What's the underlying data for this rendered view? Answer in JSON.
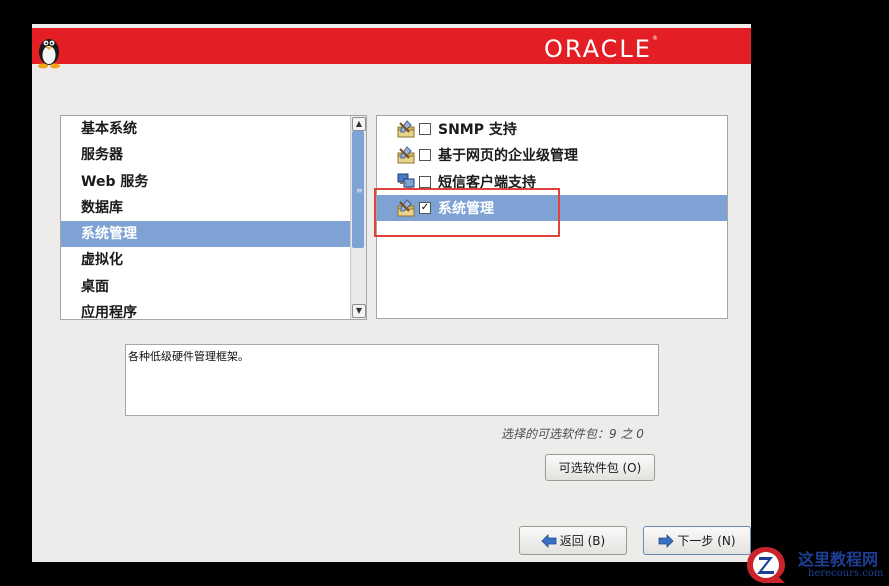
{
  "banner": {
    "brand": "ORACLE"
  },
  "categories": {
    "items": [
      {
        "label": "基本系统",
        "selected": false
      },
      {
        "label": "服务器",
        "selected": false
      },
      {
        "label": "Web 服务",
        "selected": false
      },
      {
        "label": "数据库",
        "selected": false
      },
      {
        "label": "系统管理",
        "selected": true
      },
      {
        "label": "虚拟化",
        "selected": false
      },
      {
        "label": "桌面",
        "selected": false
      },
      {
        "label": "应用程序",
        "selected": false
      }
    ]
  },
  "packages": {
    "items": [
      {
        "label": "SNMP 支持",
        "checked": false,
        "icon": "package-tools-icon",
        "selected": false
      },
      {
        "label": "基于网页的企业级管理",
        "checked": false,
        "icon": "package-tools-icon",
        "selected": false
      },
      {
        "label": "短信客户端支持",
        "checked": false,
        "icon": "computer-network-icon",
        "selected": false
      },
      {
        "label": "系统管理",
        "checked": true,
        "icon": "package-tools-icon",
        "selected": true
      }
    ]
  },
  "description": "各种低级硬件管理框架。",
  "optional_count": "选择的可选软件包：9 之 0",
  "buttons": {
    "optional": "可选软件包 (O)",
    "back": "返回 (B)",
    "next": "下一步 (N)"
  },
  "watermark": {
    "title": "这里教程网",
    "url": "herecours.com"
  },
  "colors": {
    "banner": "#e31e24",
    "selection": "#7ea2d4",
    "highlight": "#e0413b"
  }
}
